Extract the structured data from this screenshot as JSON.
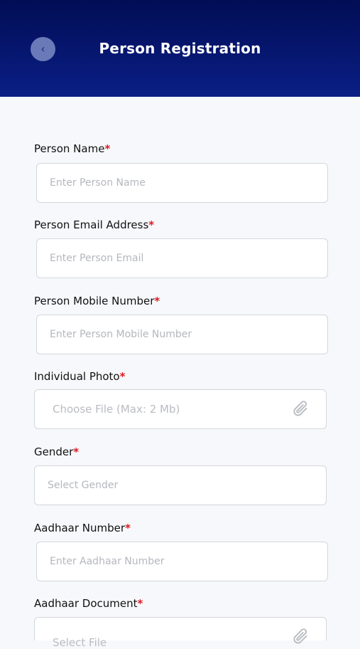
{
  "header": {
    "title": "Person Registration",
    "back_icon": "chevron-left-icon"
  },
  "form": {
    "required_mark": "*",
    "fields": [
      {
        "label": "Person Name",
        "placeholder": "Enter Person Name"
      },
      {
        "label": "Person Email Address",
        "placeholder": "Enter Person Email"
      },
      {
        "label": "Person Mobile Number",
        "placeholder": "Enter Person Mobile Number"
      },
      {
        "label": "Individual Photo",
        "placeholder": "Choose File (Max: 2 Mb)",
        "icon": "paperclip-icon"
      },
      {
        "label": "Gender",
        "placeholder": "Select Gender"
      },
      {
        "label": "Aadhaar Number",
        "placeholder": "Enter Aadhaar Number"
      },
      {
        "label": "Aadhaar Document",
        "placeholder": "Select File",
        "icon": "paperclip-icon"
      }
    ]
  },
  "colors": {
    "header_top": "#020d55",
    "header_bottom": "#0a1f86",
    "required": "#e0191f",
    "background": "#f7f8fb"
  }
}
